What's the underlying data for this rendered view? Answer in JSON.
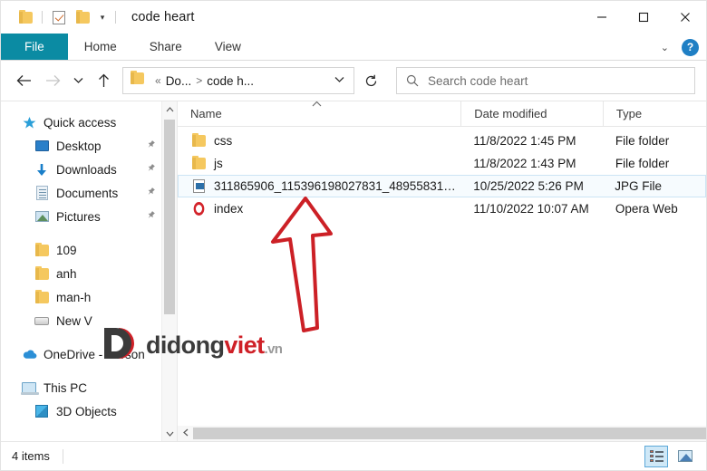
{
  "window": {
    "title": "code heart",
    "quick_access_toolbar": [
      {
        "name": "folder-icon",
        "label": "folder"
      },
      {
        "name": "properties-icon",
        "label": "properties"
      },
      {
        "name": "new-folder-icon",
        "label": "new folder"
      },
      {
        "name": "customize-caret-icon",
        "label": "▾"
      }
    ],
    "controls": {
      "minimize": "minimize",
      "maximize": "maximize",
      "close": "close"
    }
  },
  "ribbon": {
    "tabs": [
      {
        "label": "File",
        "active": true
      },
      {
        "label": "Home",
        "active": false
      },
      {
        "label": "Share",
        "active": false
      },
      {
        "label": "View",
        "active": false
      }
    ],
    "collapse_caret": "⌄",
    "help_label": "?",
    "file_tab_color": "#0b8ba3"
  },
  "address": {
    "back": "←",
    "forward": "→",
    "recent": "⌄",
    "up": "↑",
    "breadcrumb": {
      "overflow": "«",
      "segments": [
        "Do...",
        "code h..."
      ],
      "separator": ">",
      "caret": "⌄"
    },
    "refresh": "↻"
  },
  "search": {
    "placeholder": "Search code heart",
    "icon": "search-icon"
  },
  "navpane": {
    "items": [
      {
        "label": "Quick access",
        "icon": "star-icon",
        "indent": 0,
        "pinned": false
      },
      {
        "label": "Desktop",
        "icon": "desktop-icon",
        "indent": 1,
        "pinned": true
      },
      {
        "label": "Downloads",
        "icon": "downloads-icon",
        "indent": 1,
        "pinned": true
      },
      {
        "label": "Documents",
        "icon": "documents-icon",
        "indent": 1,
        "pinned": true
      },
      {
        "label": "Pictures",
        "icon": "pictures-icon",
        "indent": 1,
        "pinned": true
      },
      {
        "label": "109",
        "icon": "folder-icon",
        "indent": 1,
        "pinned": false
      },
      {
        "label": "anh",
        "icon": "folder-icon",
        "indent": 1,
        "pinned": false
      },
      {
        "label": "man-h",
        "icon": "folder-icon",
        "indent": 1,
        "pinned": false
      },
      {
        "label": "New V",
        "icon": "drive-icon",
        "indent": 1,
        "pinned": false
      },
      {
        "label": "OneDrive - Person",
        "icon": "onedrive-icon",
        "indent": 0,
        "pinned": false
      },
      {
        "label": "This PC",
        "icon": "this-pc-icon",
        "indent": 0,
        "pinned": false
      },
      {
        "label": "3D Objects",
        "icon": "3d-objects-icon",
        "indent": 1,
        "pinned": false
      }
    ],
    "pin_glyph": "📌"
  },
  "filelist": {
    "columns": [
      {
        "label": "Name",
        "sorted": "asc"
      },
      {
        "label": "Date modified",
        "sorted": null
      },
      {
        "label": "Type",
        "sorted": null
      }
    ],
    "sort_chevron": "⌃",
    "rows": [
      {
        "name": "css",
        "date": "11/8/2022 1:45 PM",
        "type": "File folder",
        "icon": "folder-icon",
        "selected": false
      },
      {
        "name": "js",
        "date": "11/8/2022 1:43 PM",
        "type": "File folder",
        "icon": "folder-icon",
        "selected": false
      },
      {
        "name": "311865906_115396198027831_48955831…",
        "date": "10/25/2022 5:26 PM",
        "type": "JPG File",
        "icon": "jpg-file-icon",
        "selected": true
      },
      {
        "name": "index",
        "date": "11/10/2022 10:07 AM",
        "type": "Opera Web",
        "icon": "opera-icon",
        "selected": false
      }
    ]
  },
  "statusbar": {
    "item_count": "4 items",
    "views": [
      {
        "name": "details-view",
        "active": true
      },
      {
        "name": "large-icons-view",
        "active": false
      }
    ]
  },
  "annotation": {
    "arrow_color": "#cc2026",
    "points_to": "311865906_115396198027831_48955831…"
  },
  "watermark": {
    "part1": "didong",
    "part2": "viet",
    "part3": ".vn",
    "color1": "#3b3b3b",
    "color2": "#cf2027"
  }
}
